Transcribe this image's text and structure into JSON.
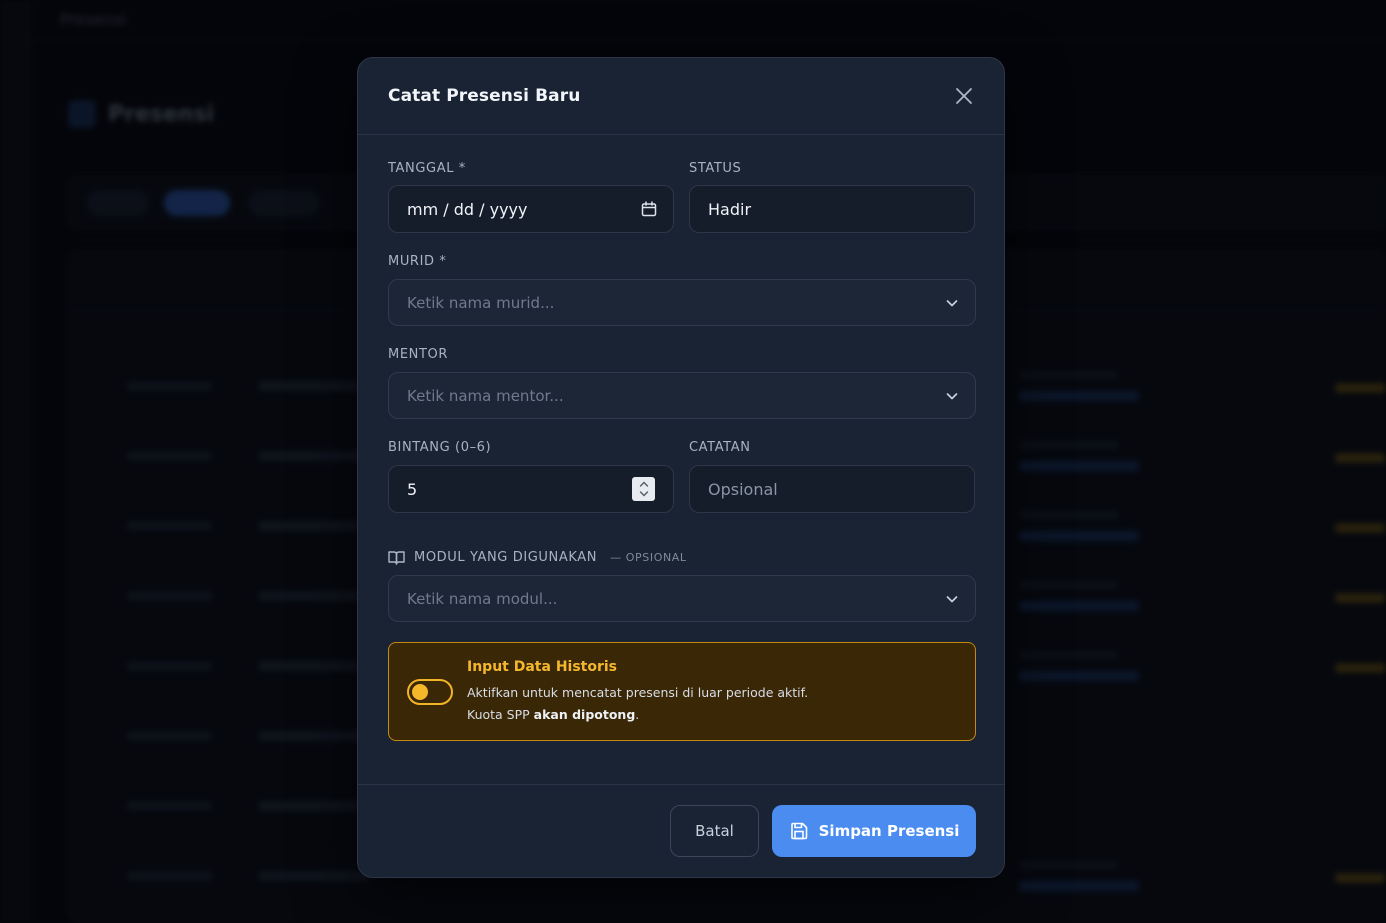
{
  "background": {
    "top_title": "Presensi",
    "page_title": "Presensi"
  },
  "modal": {
    "title": "Catat Presensi Baru",
    "fields": {
      "tanggal": {
        "label": "TANGGAL *",
        "value": "mm / dd / yyyy"
      },
      "status": {
        "label": "STATUS",
        "value": "Hadir"
      },
      "murid": {
        "label": "MURID *",
        "placeholder": "Ketik nama murid..."
      },
      "mentor": {
        "label": "MENTOR",
        "placeholder": "Ketik nama mentor..."
      },
      "bintang": {
        "label": "BINTANG (0–6)",
        "value": "5"
      },
      "catatan": {
        "label": "CATATAN",
        "placeholder": "Opsional"
      },
      "modul": {
        "label": "MODUL YANG DIGUNAKAN",
        "optional_tag": "— OPSIONAL",
        "placeholder": "Ketik nama modul..."
      }
    },
    "historis": {
      "title": "Input Data Historis",
      "description": "Aktifkan untuk mencatat presensi di luar periode aktif.",
      "note_prefix": "Kuota SPP ",
      "note_bold": "akan dipotong",
      "note_suffix": ".",
      "toggle_on": false
    },
    "footer": {
      "cancel_label": "Batal",
      "save_label": "Simpan Presensi"
    }
  },
  "colors": {
    "accent": "#4a8cf0",
    "warning": "#f5b72e",
    "modal_bg": "#1a2333"
  }
}
